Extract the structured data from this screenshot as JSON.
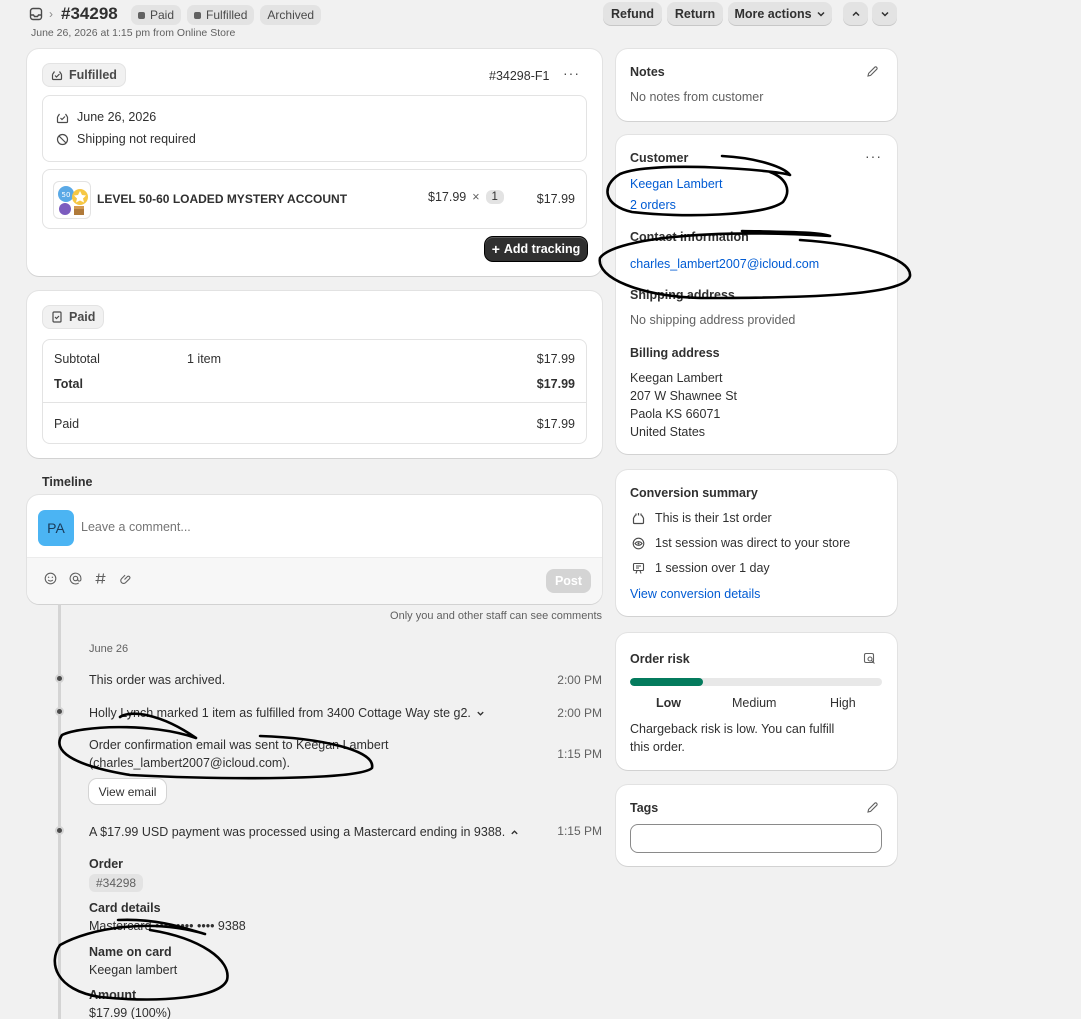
{
  "header": {
    "order_number": "#34298",
    "badges": [
      "Paid",
      "Fulfilled",
      "Archived"
    ],
    "subtitle": "June 26, 2026 at 1:15 pm from Online Store",
    "actions": {
      "refund": "Refund",
      "return": "Return",
      "more": "More actions"
    }
  },
  "fulfillment": {
    "status": "Fulfilled",
    "id": "#34298-F1",
    "date": "June 26, 2026",
    "shipping": "Shipping not required",
    "item": {
      "name": "LEVEL 50-60 LOADED MYSTERY ACCOUNT",
      "price": "$17.99",
      "times": "×",
      "qty": "1",
      "total": "$17.99"
    },
    "add_tracking": "Add tracking"
  },
  "payment": {
    "status": "Paid",
    "subtotal_label": "Subtotal",
    "subtotal_items": "1 item",
    "subtotal_value": "$17.99",
    "total_label": "Total",
    "total_value": "$17.99",
    "paid_label": "Paid",
    "paid_value": "$17.99"
  },
  "timeline": {
    "title": "Timeline",
    "avatar": "PA",
    "comment_placeholder": "Leave a comment...",
    "post": "Post",
    "staff_note": "Only you and other staff can see comments",
    "date": "June 26",
    "events": [
      {
        "text": "This order was archived.",
        "time": "2:00 PM"
      },
      {
        "text": "Holly Lynch marked 1 item as fulfilled from 3400 Cottage Way ste g2.",
        "time": "2:00 PM"
      },
      {
        "text": "Order confirmation email was sent to Keegan Lambert",
        "text2": "(charles_lambert2007@icloud.com).",
        "time": "1:15 PM",
        "button": "View email"
      },
      {
        "text": "A $17.99 USD payment was processed using a Mastercard ending in 9388.",
        "time": "1:15 PM"
      }
    ],
    "details": {
      "order_label": "Order",
      "order_value": "#34298",
      "card_label": "Card details",
      "card_value": "Mastercard •••• •••• •••• 9388",
      "name_label": "Name on card",
      "name_value": "Keegan lambert",
      "amount_label": "Amount",
      "amount_value": "$17.99 (100%)"
    }
  },
  "notes": {
    "title": "Notes",
    "text": "No notes from customer"
  },
  "customer": {
    "title": "Customer",
    "name": "Keegan Lambert",
    "orders": "2 orders",
    "contact_title": "Contact information",
    "email": "charles_lambert2007@icloud.com",
    "shipping_title": "Shipping address",
    "shipping_text": "No shipping address provided",
    "billing_title": "Billing address",
    "billing_lines": [
      "Keegan Lambert",
      "207 W Shawnee St",
      "Paola KS 66071",
      "United States"
    ]
  },
  "conversion": {
    "title": "Conversion summary",
    "items": [
      "This is their 1st order",
      "1st session was direct to your store",
      "1 session over 1 day"
    ],
    "link": "View conversion details"
  },
  "risk": {
    "title": "Order risk",
    "level": 0.29,
    "labels": [
      "Low",
      "Medium",
      "High"
    ],
    "text1": "Chargeback risk is low. You can fulfill",
    "text2": "this order."
  },
  "tags": {
    "title": "Tags"
  },
  "colors": {
    "risk_fill": "#047b5d",
    "link": "#005bd3"
  }
}
